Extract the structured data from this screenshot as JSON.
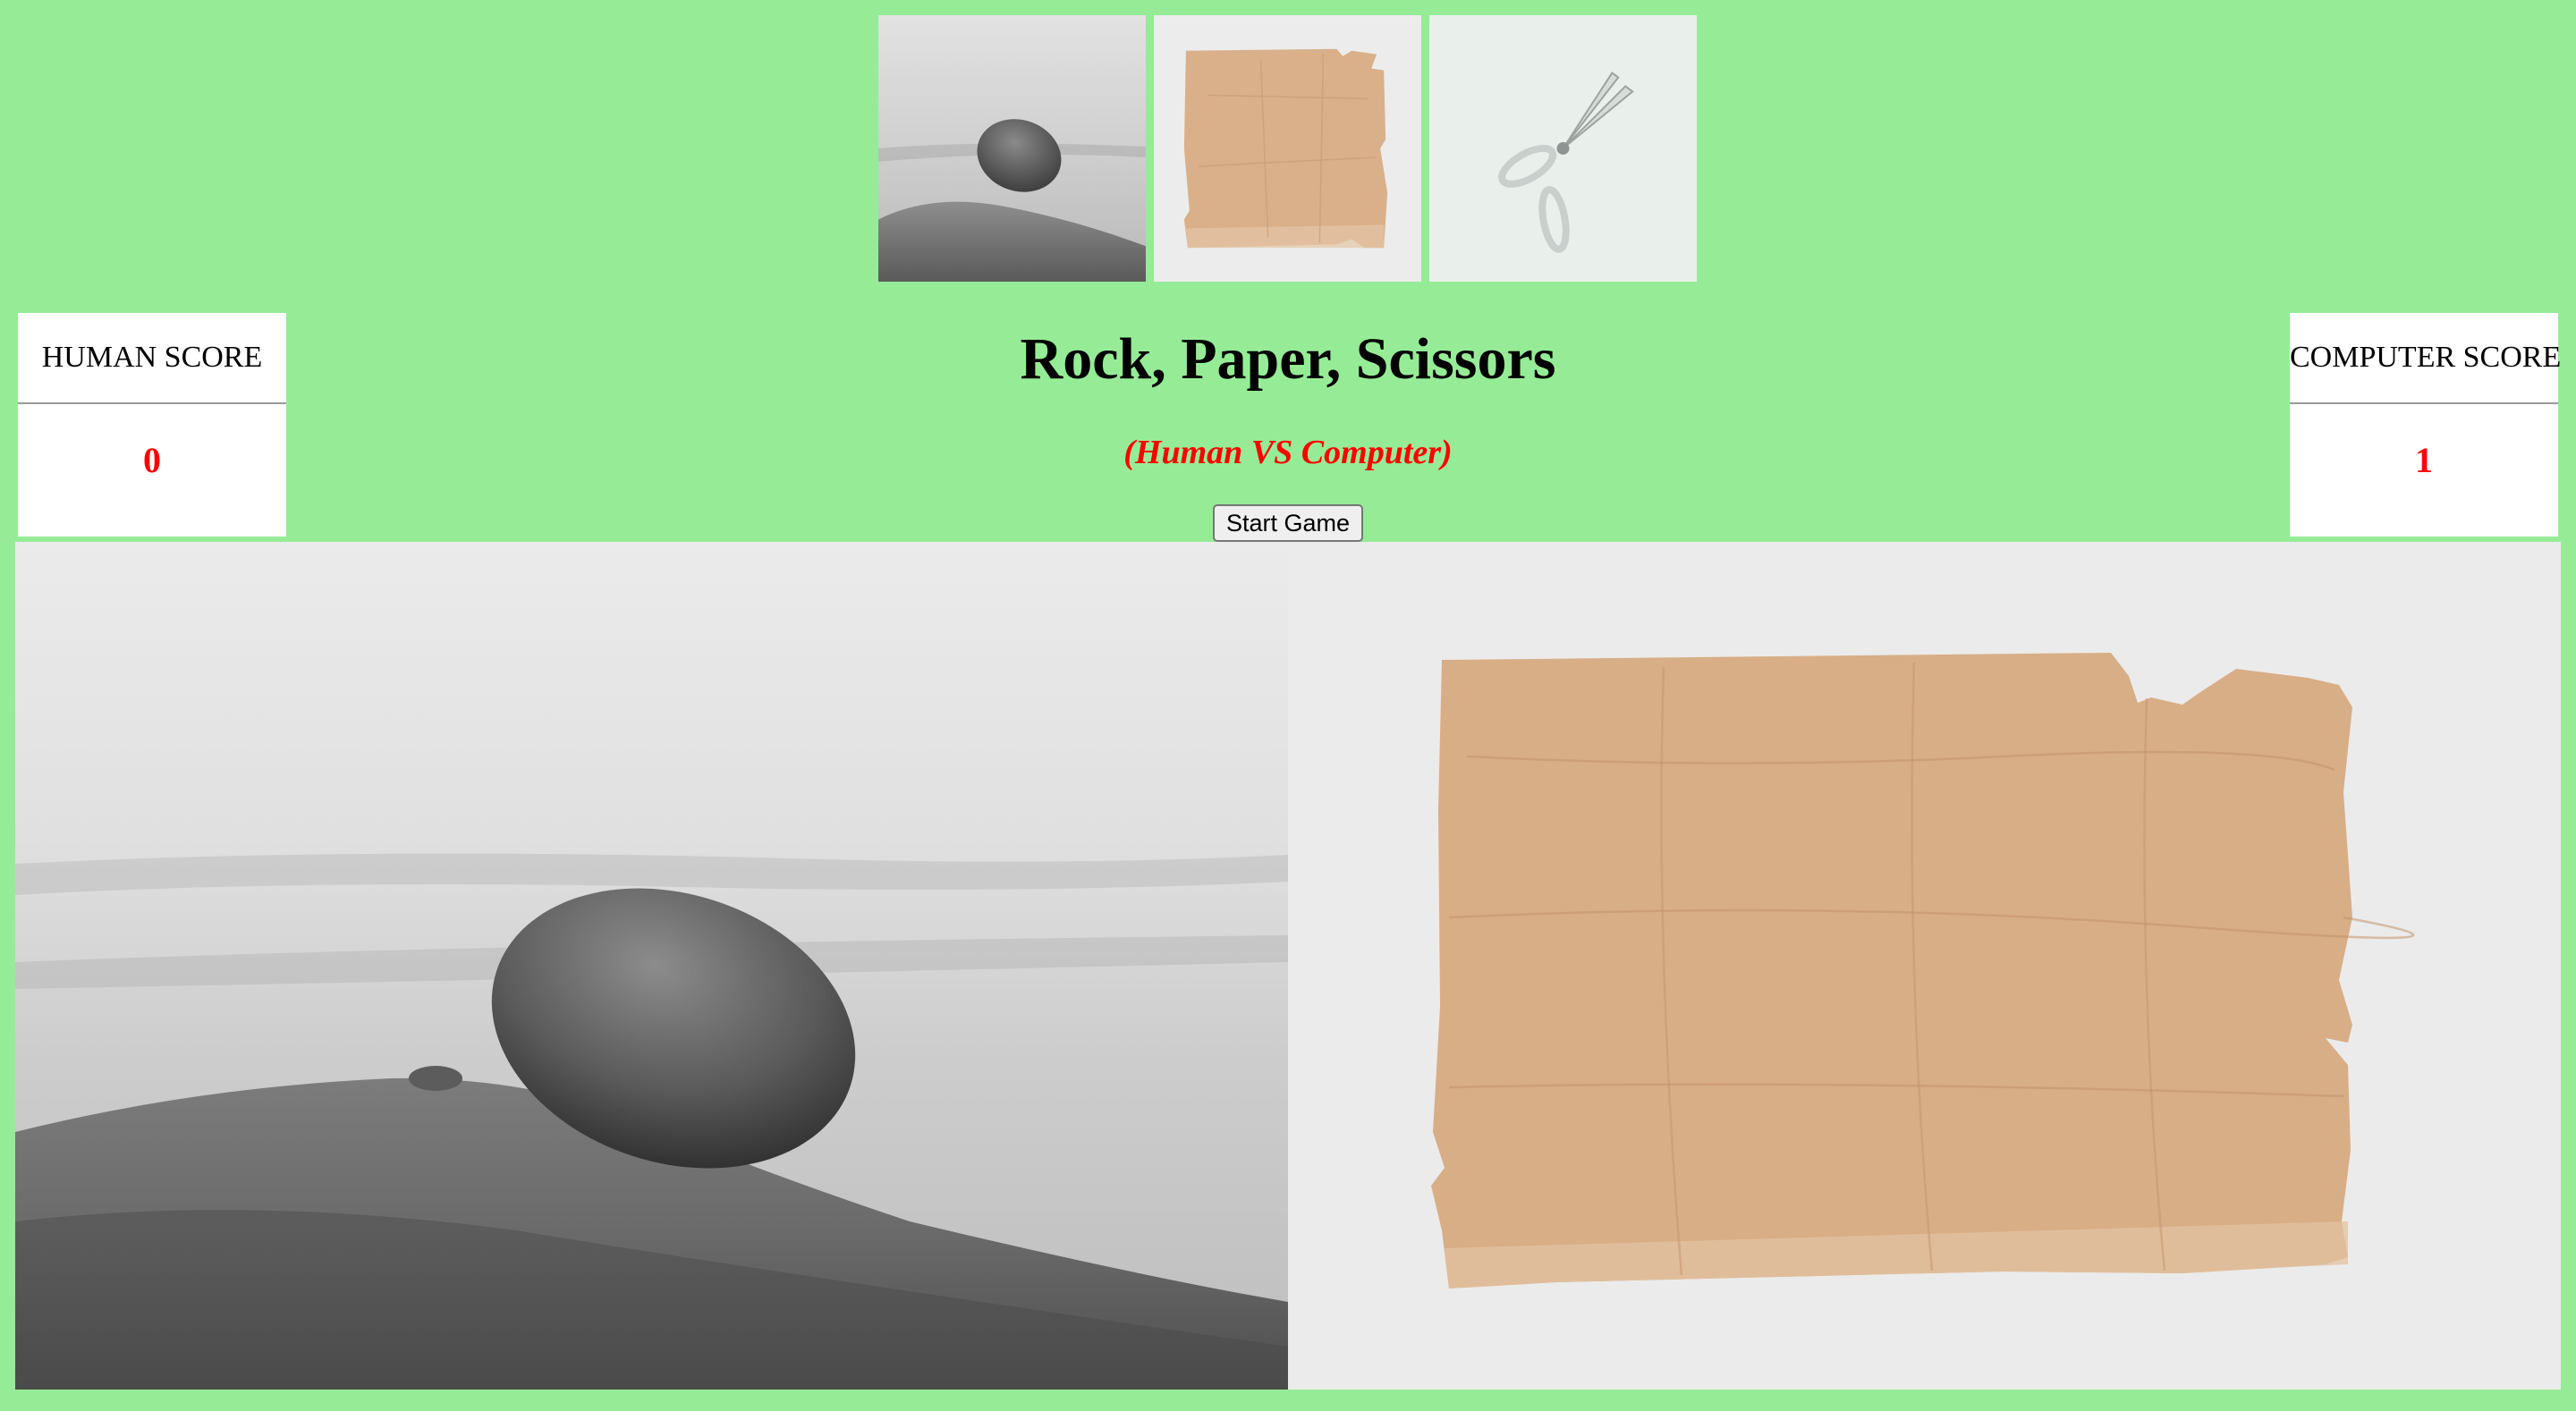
{
  "app": {
    "title": "Rock, Paper, Scissors",
    "subtitle": "(Human VS Computer)",
    "background_color": "#96ec96",
    "accent_color": "#ff0000"
  },
  "choices": [
    {
      "name": "rock",
      "image": "rock-on-sand"
    },
    {
      "name": "paper",
      "image": "torn-brown-paper"
    },
    {
      "name": "scissors",
      "image": "silver-scissors"
    }
  ],
  "scores": {
    "human": {
      "label": "HUMAN SCORE",
      "value": "0"
    },
    "computer": {
      "label": "COMPUTER SCORE",
      "value": "1"
    }
  },
  "controls": {
    "start_label": "Start Game"
  },
  "result": {
    "human_choice": "rock",
    "computer_choice": "paper"
  }
}
